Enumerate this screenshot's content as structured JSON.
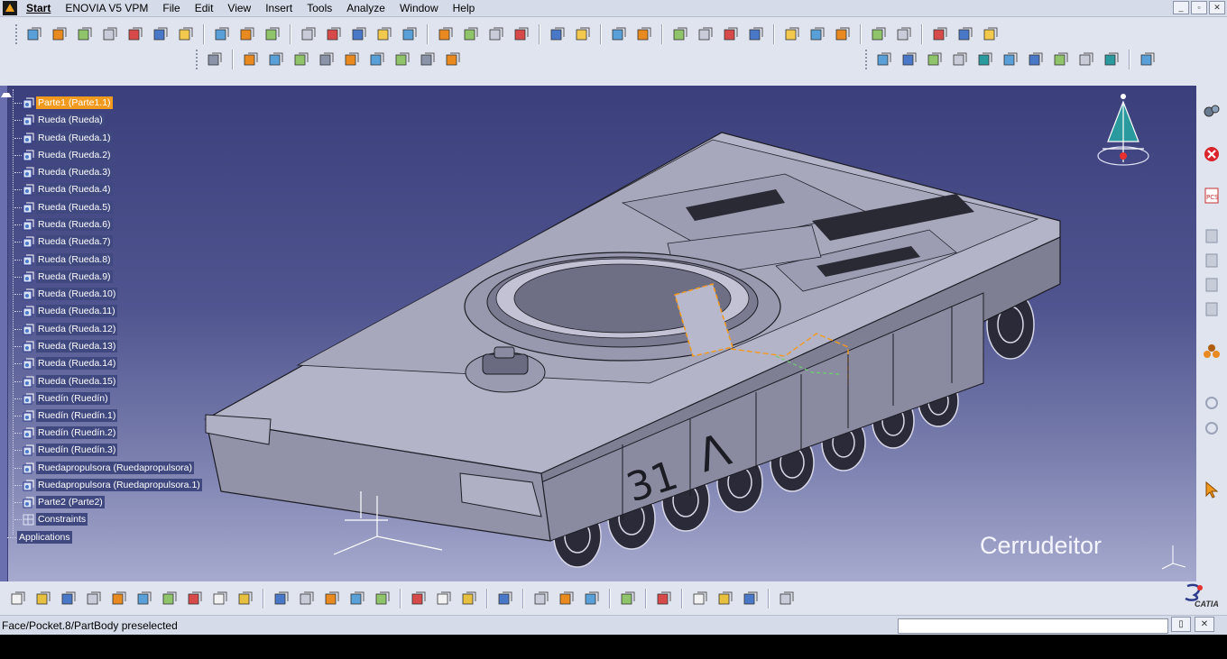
{
  "menubar": {
    "items": [
      "Start",
      "ENOVIA V5 VPM",
      "File",
      "Edit",
      "View",
      "Insert",
      "Tools",
      "Analyze",
      "Window",
      "Help"
    ],
    "window_controls": [
      "_",
      "▫",
      "✕"
    ]
  },
  "tree": {
    "nodes": [
      {
        "label": "Parte1 (Parte1.1)",
        "selected": true,
        "icon": "part-icon"
      },
      {
        "label": "Rueda (Rueda)",
        "icon": "part-icon"
      },
      {
        "label": "Rueda (Rueda.1)",
        "icon": "part-icon"
      },
      {
        "label": "Rueda (Rueda.2)",
        "icon": "part-icon"
      },
      {
        "label": "Rueda (Rueda.3)",
        "icon": "part-icon"
      },
      {
        "label": "Rueda (Rueda.4)",
        "icon": "part-icon"
      },
      {
        "label": "Rueda (Rueda.5)",
        "icon": "part-icon"
      },
      {
        "label": "Rueda (Rueda.6)",
        "icon": "part-icon"
      },
      {
        "label": "Rueda (Rueda.7)",
        "icon": "part-icon"
      },
      {
        "label": "Rueda (Rueda.8)",
        "icon": "part-icon"
      },
      {
        "label": "Rueda (Rueda.9)",
        "icon": "part-icon"
      },
      {
        "label": "Rueda (Rueda.10)",
        "icon": "part-icon"
      },
      {
        "label": "Rueda (Rueda.11)",
        "icon": "part-icon"
      },
      {
        "label": "Rueda (Rueda.12)",
        "icon": "part-icon"
      },
      {
        "label": "Rueda (Rueda.13)",
        "icon": "part-icon"
      },
      {
        "label": "Rueda (Rueda.14)",
        "icon": "part-icon"
      },
      {
        "label": "Rueda (Rueda.15)",
        "icon": "part-icon"
      },
      {
        "label": "Ruedín (Ruedín)",
        "icon": "part-icon"
      },
      {
        "label": "Ruedín (Ruedín.1)",
        "icon": "part-icon"
      },
      {
        "label": "Ruedín (Ruedín.2)",
        "icon": "part-icon"
      },
      {
        "label": "Ruedín (Ruedín.3)",
        "icon": "part-icon"
      },
      {
        "label": "Ruedapropulsora (Ruedapropulsora)",
        "icon": "part-icon"
      },
      {
        "label": "Ruedapropulsora (Ruedapropulsora.1)",
        "icon": "part-icon"
      },
      {
        "label": "Parte2 (Parte2)",
        "icon": "part-icon"
      },
      {
        "label": "Constraints",
        "icon": "constraints-icon"
      },
      {
        "label": "Applications",
        "icon": "applications-icon"
      }
    ]
  },
  "model": {
    "hull_number": "31",
    "hull_marking": "Λ"
  },
  "watermark": "Cerrudeitor",
  "status": {
    "message": "Face/Pocket.8/PartBody preselected",
    "command_value": ""
  },
  "logo_text": "CATIA",
  "colors": {
    "selection": "#f29a1e",
    "viewport_top": "#3b3f7b",
    "viewport_bottom": "#a7aace",
    "toolbar_bg": "#dfe4ee"
  }
}
